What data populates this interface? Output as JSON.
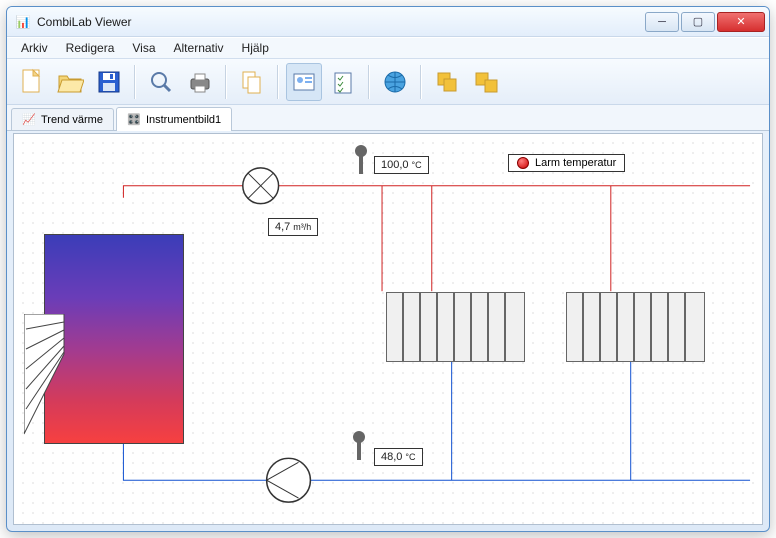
{
  "window": {
    "title": "CombiLab Viewer"
  },
  "menu": {
    "items": [
      "Arkiv",
      "Redigera",
      "Visa",
      "Alternativ",
      "Hjälp"
    ]
  },
  "tabs": {
    "items": [
      {
        "label": "Trend värme",
        "active": false
      },
      {
        "label": "Instrumentbild1",
        "active": true
      }
    ]
  },
  "readings": {
    "supply_temp": {
      "value": "100,0",
      "unit": "°C"
    },
    "flow": {
      "value": "4,7",
      "unit": "m³/h"
    },
    "return_temp": {
      "value": "48,0",
      "unit": "°C"
    }
  },
  "alarm": {
    "label": "Larm temperatur",
    "active": true
  },
  "colors": {
    "hot": "#d02020",
    "cold": "#1050d0"
  }
}
